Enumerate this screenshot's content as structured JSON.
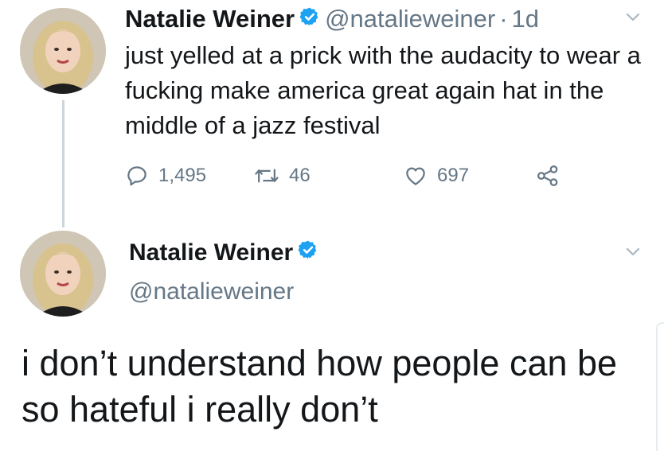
{
  "tweet1": {
    "name": "Natalie Weiner",
    "handle": "@natalieweiner",
    "separator": "·",
    "time": "1d",
    "text": "just yelled at a prick with the audacity to wear a fucking make america great again hat in the middle of a jazz festival",
    "replies": "1,495",
    "retweets": "46",
    "likes": "697"
  },
  "tweet2": {
    "name": "Natalie Weiner",
    "handle": "@natalieweiner",
    "text": "i don’t understand how people can be so hateful i really don’t"
  },
  "icons": {
    "verified": "verified-badge-icon",
    "caret": "chevron-down-icon",
    "reply": "reply-icon",
    "retweet": "retweet-icon",
    "like": "heart-icon",
    "share": "share-icon"
  },
  "colors": {
    "verified": "#1da1f2",
    "secondary_text": "#657786",
    "primary_text": "#14171a",
    "thread_line": "#ccd6dd"
  }
}
